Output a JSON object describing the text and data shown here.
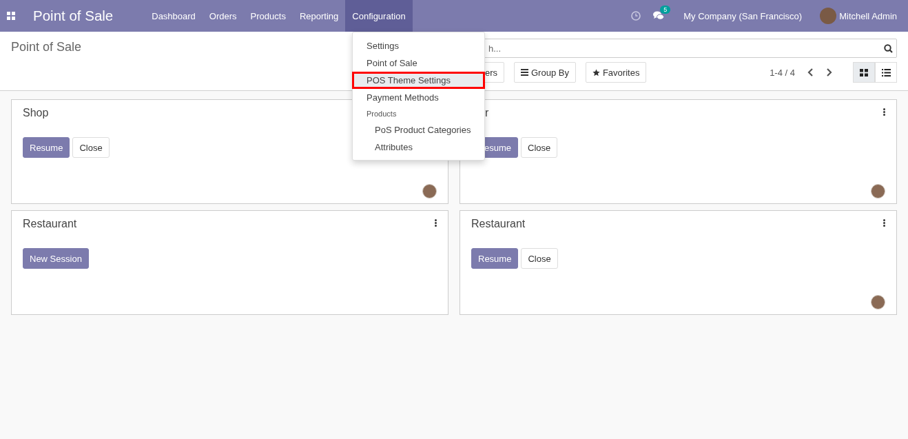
{
  "navbar": {
    "app_title": "Point of Sale",
    "menu": [
      {
        "label": "Dashboard",
        "selected": false
      },
      {
        "label": "Orders",
        "selected": false
      },
      {
        "label": "Products",
        "selected": false
      },
      {
        "label": "Reporting",
        "selected": false
      },
      {
        "label": "Configuration",
        "selected": true
      }
    ],
    "message_count": "5",
    "company": "My Company (San Francisco)",
    "user": "Mitchell Admin"
  },
  "control_panel": {
    "breadcrumb": "Point of Sale",
    "search": {
      "placeholder": "h..."
    },
    "filters_button": "ers",
    "group_by_button": "Group By",
    "favorites_button": "Favorites",
    "pager": "1-4 / 4",
    "views": [
      {
        "kind": "kanban",
        "selected": true
      },
      {
        "kind": "list",
        "selected": false
      }
    ]
  },
  "dropdown": {
    "items": [
      {
        "kind": "item",
        "label": "Settings",
        "highlighted": false
      },
      {
        "kind": "item",
        "label": "Point of Sale",
        "highlighted": false
      },
      {
        "kind": "item",
        "label": "POS Theme Settings",
        "highlighted": true
      },
      {
        "kind": "item",
        "label": "Payment Methods",
        "highlighted": false
      },
      {
        "kind": "header",
        "label": "Products",
        "highlighted": false
      },
      {
        "kind": "subitem",
        "label": "PoS Product Categories",
        "highlighted": false
      },
      {
        "kind": "subitem",
        "label": "Attributes",
        "highlighted": false
      }
    ]
  },
  "cards": [
    {
      "title": "Shop",
      "menu": false,
      "avatar": true,
      "buttons": [
        {
          "kind": "primary",
          "label": "Resume"
        },
        {
          "kind": "secondary",
          "label": "Close"
        }
      ]
    },
    {
      "title": "r",
      "menu": true,
      "avatar": true,
      "buttons": [
        {
          "kind": "primary",
          "label": "esume"
        },
        {
          "kind": "secondary",
          "label": "Close"
        }
      ]
    },
    {
      "title": "Restaurant",
      "menu": true,
      "avatar": false,
      "buttons": [
        {
          "kind": "primary",
          "label": "New Session"
        }
      ]
    },
    {
      "title": "Restaurant",
      "menu": true,
      "avatar": true,
      "buttons": [
        {
          "kind": "primary",
          "label": "Resume"
        },
        {
          "kind": "secondary",
          "label": "Close"
        }
      ]
    }
  ]
}
